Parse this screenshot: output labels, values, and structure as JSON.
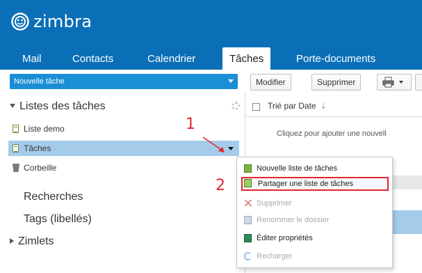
{
  "app": {
    "logo_text": "zimbra"
  },
  "tabs": [
    {
      "label": "Mail"
    },
    {
      "label": "Contacts"
    },
    {
      "label": "Calendrier"
    },
    {
      "label": "Tâches",
      "active": true
    },
    {
      "label": "Porte-documents"
    }
  ],
  "new_task": {
    "label": "Nouvelle tâche"
  },
  "toolbar": {
    "modify_label": "Modifier",
    "delete_label": "Supprimer",
    "print_icon": "printer-icon"
  },
  "sidebar": {
    "tasklists_header": "Listes des tâches",
    "items": [
      {
        "label": "Liste demo",
        "icon": "task-list-icon"
      },
      {
        "label": "Tâches",
        "icon": "task-list-icon",
        "selected": true
      },
      {
        "label": "Corbeille",
        "icon": "trash-icon"
      }
    ],
    "searches_header": "Recherches",
    "tags_header": "Tags (libellés)",
    "zimlets_header": "Zimlets"
  },
  "list": {
    "sort_label": "Trié par Date",
    "add_hint": "Cliquez pour ajouter une nouvell"
  },
  "context_menu": {
    "items": [
      {
        "label": "Nouvelle liste de tâches",
        "icon": "new-task-list-icon",
        "enabled": true
      },
      {
        "label": "Partager une liste de tâches",
        "icon": "share-task-list-icon",
        "enabled": true,
        "highlighted": true
      },
      {
        "label": "Supprimer",
        "icon": "delete-icon",
        "enabled": false
      },
      {
        "label": "Renommer le dossier",
        "icon": "rename-icon",
        "enabled": false
      },
      {
        "label": "Éditer propriétés",
        "icon": "edit-properties-icon",
        "enabled": true
      },
      {
        "label": "Recharger",
        "icon": "reload-icon",
        "enabled": false
      }
    ]
  },
  "annotations": {
    "step1": "1",
    "step2": "2",
    "color": "#e3262d"
  },
  "colors": {
    "header_blue": "#0a6fb7",
    "button_blue": "#1b8fd6",
    "selection_blue": "#a5cbea"
  }
}
